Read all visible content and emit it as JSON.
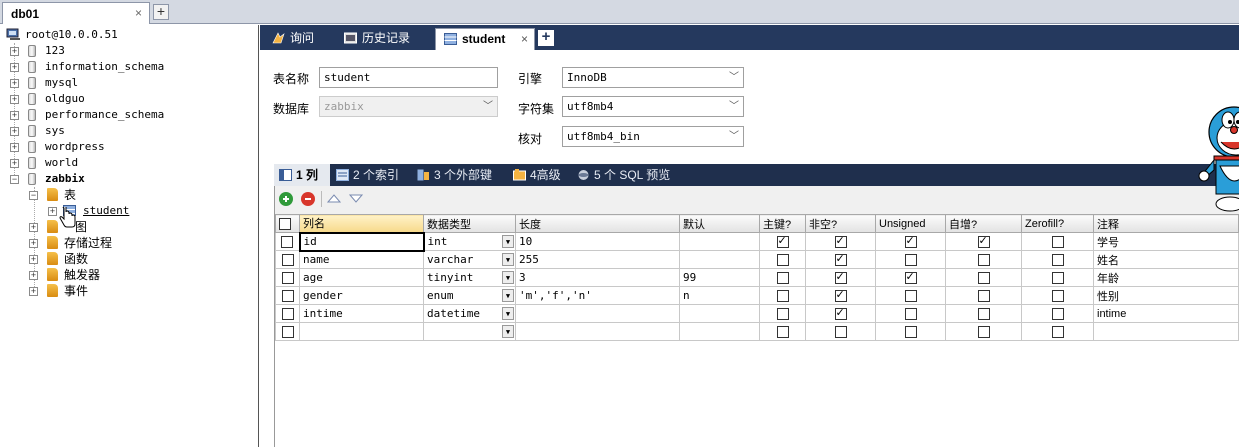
{
  "doc_tab": {
    "title": "db01",
    "close": "×",
    "add": "+"
  },
  "tree": {
    "root": "root@10.0.0.51",
    "databases": [
      "123",
      "information_schema",
      "mysql",
      "oldguo",
      "performance_schema",
      "sys",
      "wordpress",
      "world",
      "zabbix"
    ],
    "zabbix_children": {
      "tables_label": "表",
      "table_item": "student",
      "views_label": "图",
      "procs_label": "存储过程",
      "funcs_label": "函数",
      "triggers_label": "触发器",
      "events_label": "事件"
    }
  },
  "object_tabs": [
    {
      "label": "询问"
    },
    {
      "label": "历史记录"
    },
    {
      "label": "student",
      "close": "×"
    }
  ],
  "object_add": "+",
  "form": {
    "table_name_label": "表名称",
    "table_name_value": "student",
    "database_label": "数据库",
    "database_value": "zabbix",
    "engine_label": "引擎",
    "engine_value": "InnoDB",
    "charset_label": "字符集",
    "charset_value": "utf8mb4",
    "collation_label": "核对",
    "collation_value": "utf8mb4_bin",
    "dropdown_arrow": "﹀"
  },
  "sub_tabs": [
    "1 列",
    "2 个索引",
    "3 个外部键",
    "4高级",
    "5 个 SQL 预览"
  ],
  "grid": {
    "headers": [
      "列名",
      "数据类型",
      "长度",
      "默认",
      "主键?",
      "非空?",
      "Unsigned",
      "自增?",
      "Zerofill?",
      "注释"
    ],
    "rows": [
      {
        "name": "id",
        "type": "int",
        "length": "10",
        "default": "",
        "pk": true,
        "notnull": true,
        "unsigned": true,
        "ai": true,
        "zerofill": false,
        "comment": "学号"
      },
      {
        "name": "name",
        "type": "varchar",
        "length": "255",
        "default": "",
        "pk": false,
        "notnull": true,
        "unsigned": false,
        "ai": false,
        "zerofill": false,
        "comment": "姓名"
      },
      {
        "name": "age",
        "type": "tinyint",
        "length": "3",
        "default": "99",
        "pk": false,
        "notnull": true,
        "unsigned": true,
        "ai": false,
        "zerofill": false,
        "comment": "年龄"
      },
      {
        "name": "gender",
        "type": "enum",
        "length": "'m','f','n'",
        "default": "n",
        "pk": false,
        "notnull": true,
        "unsigned": false,
        "ai": false,
        "zerofill": false,
        "comment": "性别"
      },
      {
        "name": "intime",
        "type": "datetime",
        "length": "",
        "default": "",
        "pk": false,
        "notnull": true,
        "unsigned": false,
        "ai": false,
        "zerofill": false,
        "comment": "intime"
      },
      {
        "name": "",
        "type": "",
        "length": "",
        "default": "",
        "pk": false,
        "notnull": false,
        "unsigned": false,
        "ai": false,
        "zerofill": false,
        "comment": ""
      }
    ]
  }
}
